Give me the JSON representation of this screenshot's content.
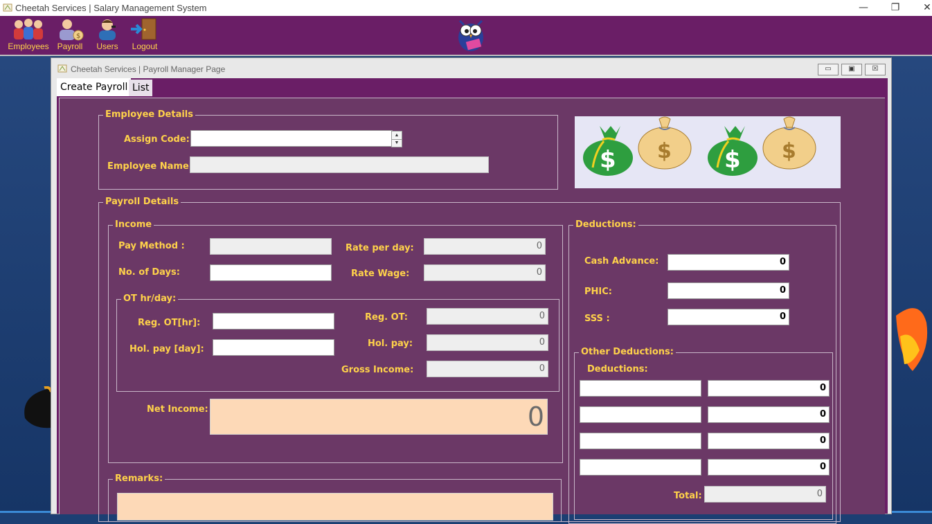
{
  "window": {
    "title": "Cheetah Services | Salary Management System",
    "controls": [
      "minimize-icon",
      "restore-icon",
      "close-icon"
    ]
  },
  "toolbar": {
    "items": [
      {
        "label": "Employees",
        "icon": "employees-icon"
      },
      {
        "label": "Payroll",
        "icon": "payroll-icon"
      },
      {
        "label": "Users",
        "icon": "users-icon"
      },
      {
        "label": "Logout",
        "icon": "logout-icon"
      }
    ],
    "logo": "owl-logo-icon"
  },
  "inner_window": {
    "title": "Cheetah Services | Payroll Manager Page",
    "tabs": [
      {
        "label": "Create Payroll",
        "active": true
      },
      {
        "label": "List",
        "active": false
      }
    ]
  },
  "employee_details": {
    "legend": "Employee Details",
    "assign_code_label": "Assign Code:",
    "assign_code_value": "",
    "employee_name_label": "Employee Name:",
    "employee_name_value": ""
  },
  "payroll_details": {
    "legend": "Payroll Details",
    "income": {
      "legend": "Income",
      "pay_method_label": "Pay Method  :",
      "pay_method_value": "",
      "rate_per_day_label": "Rate per day:",
      "rate_per_day_value": "0",
      "no_of_days_label": "No. of Days:",
      "no_of_days_value": "",
      "rate_wage_label": "Rate Wage:",
      "rate_wage_value": "0",
      "ot": {
        "legend": "OT hr/day:",
        "reg_ot_hr_label": "Reg. OT[hr]:",
        "reg_ot_hr_value": "",
        "hol_pay_day_label": "Hol. pay [day]:",
        "hol_pay_day_value": "",
        "reg_ot_label": "Reg. OT:",
        "reg_ot_value": "0",
        "hol_pay_label": "Hol. pay:",
        "hol_pay_value": "0",
        "gross_income_label": "Gross Income:",
        "gross_income_value": "0"
      },
      "net_income_label": "Net Income:",
      "net_income_value": "0"
    },
    "deductions": {
      "legend": "Deductions:",
      "cash_advance_label": "Cash Advance:",
      "cash_advance_value": "0",
      "phic_label": "PHIC:",
      "phic_value": "0",
      "sss_label": "SSS :",
      "sss_value": "0",
      "other": {
        "legend": "Other Deductions:",
        "sub_label": "Deductions:",
        "rows": [
          {
            "name": "",
            "amount": "0"
          },
          {
            "name": "",
            "amount": "0"
          },
          {
            "name": "",
            "amount": "0"
          },
          {
            "name": "",
            "amount": "0"
          }
        ],
        "total_label": "Total:",
        "total_value": "0"
      }
    }
  },
  "remarks": {
    "legend": "Remarks:",
    "value": ""
  },
  "colors": {
    "toolbar_bg": "#6a1e66",
    "panel_bg": "#6b3866",
    "label_yellow": "#ffd24a",
    "net_income_bg": "#fdd9b7",
    "money_green": "#2e9e3f",
    "money_tan": "#f2cf8a"
  }
}
